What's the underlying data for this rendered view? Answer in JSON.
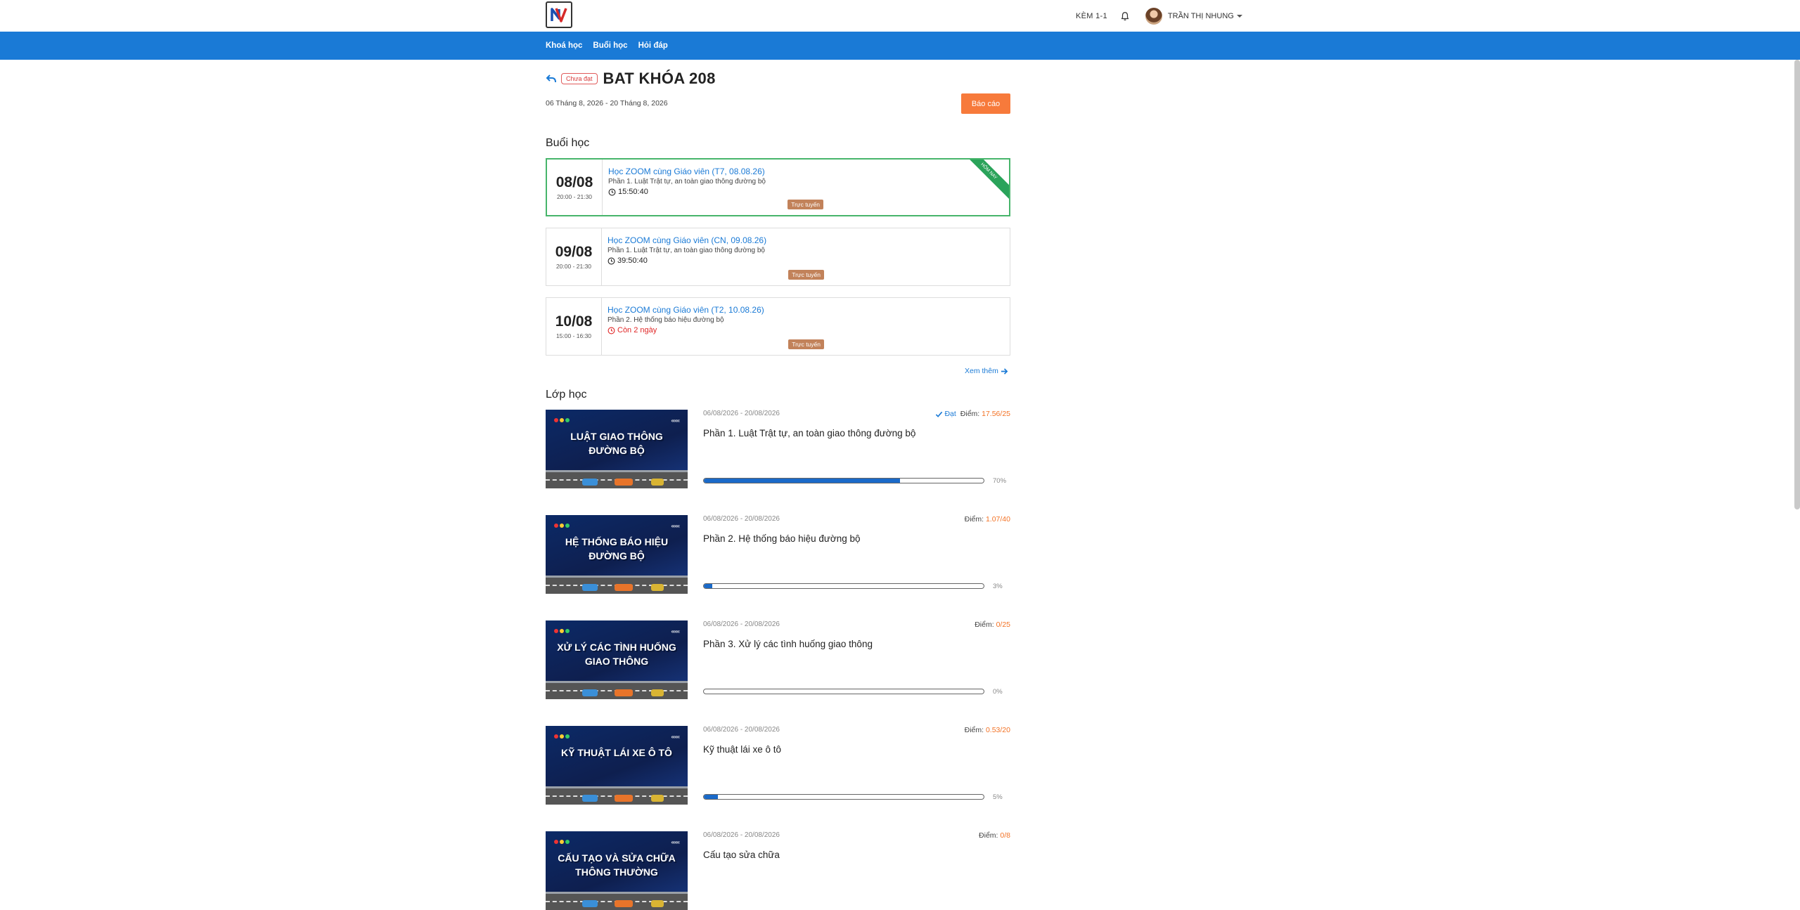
{
  "header": {
    "kem_label": "KÈM 1-1",
    "username": "TRẦN THỊ NHUNG"
  },
  "nav": [
    "Khoá học",
    "Buổi học",
    "Hỏi đáp"
  ],
  "course": {
    "status": "Chưa đạt",
    "title": "BAT KHÓA 208",
    "date_range": "06 Tháng 8, 2026 - 20 Tháng 8, 2026",
    "report_label": "Báo cáo"
  },
  "sessions_title": "Buổi học",
  "sessions": [
    {
      "day": "08/08",
      "time": "20:00 - 21:30",
      "name": "Học ZOOM cùng Giáo viên (T7, 08.08.26)",
      "part": "Phần 1. Luật Trật tự, an toàn giao thông đường bộ",
      "countdown": "15:50:40",
      "tag": "Trực tuyến",
      "ribbon": "HÔM NAY",
      "active": true,
      "red": false
    },
    {
      "day": "09/08",
      "time": "20:00 - 21:30",
      "name": "Học ZOOM cùng Giáo viên (CN, 09.08.26)",
      "part": "Phần 1. Luật Trật tự, an toàn giao thông đường bộ",
      "countdown": "39:50:40",
      "tag": "Trực tuyến",
      "ribbon": "",
      "active": false,
      "red": false
    },
    {
      "day": "10/08",
      "time": "15:00 - 16:30",
      "name": "Học ZOOM cùng Giáo viên (T2, 10.08.26)",
      "part": "Phần 2. Hệ thống báo hiệu đường bộ",
      "countdown": "Còn 2 ngày",
      "tag": "Trực tuyến",
      "ribbon": "",
      "active": false,
      "red": true
    }
  ],
  "see_more": "Xem thêm",
  "classes_title": "Lớp học",
  "score_label": "Điểm:",
  "pass_label": "Đạt",
  "classes": [
    {
      "thumb": [
        "LUẬT GIAO THÔNG",
        "ĐƯỜNG BỘ"
      ],
      "dates": "06/08/2026 - 20/08/2026",
      "name": "Phần 1. Luật Trật tự, an toàn giao thông đường bộ",
      "score": "17.56/25",
      "passed": true,
      "progress": 0.7,
      "pct": "70%"
    },
    {
      "thumb": [
        "HỆ THỐNG BÁO HIỆU",
        "ĐƯỜNG BỘ"
      ],
      "dates": "06/08/2026 - 20/08/2026",
      "name": "Phần 2. Hệ thống báo hiệu đường bộ",
      "score": "1.07/40",
      "passed": false,
      "progress": 0.03,
      "pct": "3%"
    },
    {
      "thumb": [
        "XỬ LÝ CÁC TÌNH HUỐNG",
        "GIAO THÔNG"
      ],
      "dates": "06/08/2026 - 20/08/2026",
      "name": "Phần 3. Xử lý các tình huống giao thông",
      "score": "0/25",
      "passed": false,
      "progress": 0.0,
      "pct": "0%"
    },
    {
      "thumb": [
        "KỸ THUẬT LÁI XE Ô TÔ"
      ],
      "dates": "06/08/2026 - 20/08/2026",
      "name": "Kỹ thuật lái xe ô tô",
      "score": "0.53/20",
      "passed": false,
      "progress": 0.05,
      "pct": "5%"
    },
    {
      "thumb": [
        "CẤU TẠO VÀ SỬA CHỮA",
        "THÔNG THƯỜNG"
      ],
      "dates": "06/08/2026 - 20/08/2026",
      "name": "Cấu tạo sửa chữa",
      "score": "0/8",
      "passed": false,
      "progress": null,
      "pct": ""
    }
  ],
  "colors": {
    "primary": "#1a7ad6",
    "accent": "#f77a3b",
    "success": "#2aa35a",
    "danger": "#e02626",
    "tag": "#c2825a"
  },
  "icons": [
    "logo",
    "bell-icon",
    "avatar",
    "back-arrow-icon",
    "clock-icon",
    "arrow-right-icon",
    "check-icon"
  ]
}
